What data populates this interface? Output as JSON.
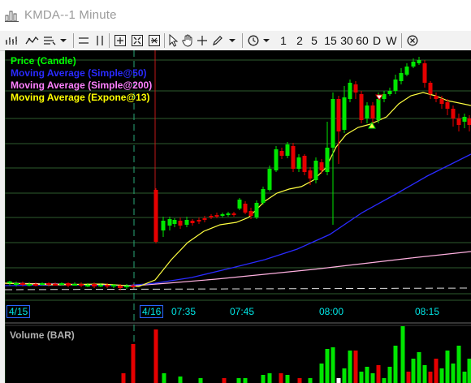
{
  "window": {
    "title": "KMDA--1 Minute",
    "app_icon": "chart-bars-icon"
  },
  "toolbar": {
    "icons": [
      "bar-style-icon",
      "draw-style-icon",
      "line-style-icon",
      "dropdown-arrow-icon",
      "horizontal-lines-icon",
      "vertical-lines-icon",
      "zoom-in-icon",
      "zoom-fit-icon",
      "zoom-out-icon",
      "pointer-icon",
      "hand-pan-icon",
      "crosshair-icon",
      "pencil-icon",
      "dropdown-arrow-icon",
      "clock-icon",
      "dropdown-arrow-icon",
      "close-circle-icon"
    ],
    "intervals": [
      "1",
      "2",
      "5",
      "15",
      "30",
      "60",
      "D",
      "W"
    ]
  },
  "legend": [
    {
      "label": "Price (Candle)",
      "color": "#00ff00"
    },
    {
      "label": "Moving Average (Simple@50)",
      "color": "#2a2aff"
    },
    {
      "label": "Moving Average (Simple@200)",
      "color": "#ff80ff"
    },
    {
      "label": "Moving Average (Expone@13)",
      "color": "#ffff00"
    }
  ],
  "xaxis": {
    "date_labels": [
      "4/15",
      "4/16"
    ],
    "time_labels": [
      "07:35",
      "07:45",
      "08:00",
      "08:15"
    ]
  },
  "volume_panel": {
    "title": "Volume (BAR)"
  },
  "colors": {
    "background": "#000000",
    "up": "#00e600",
    "down": "#e60000",
    "grid": "#2e5b2e",
    "axis_text": "#00e6e6"
  }
}
